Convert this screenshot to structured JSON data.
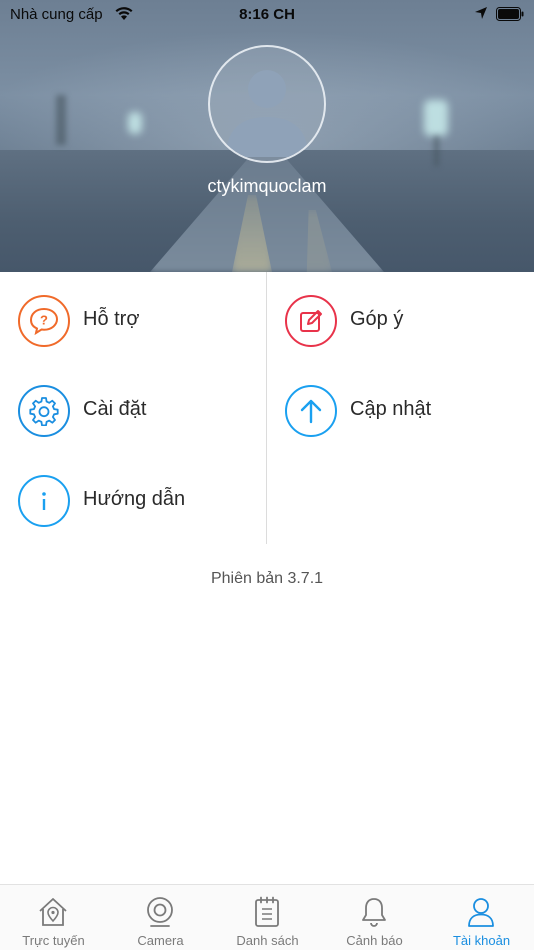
{
  "status_bar": {
    "carrier": "Nhà cung cấp",
    "time": "8:16 CH"
  },
  "profile": {
    "username": "ctykimquoclam"
  },
  "menu": {
    "items": [
      {
        "label": "Hỗ trợ",
        "icon": "help-bubble-icon",
        "color": "#f06a2a"
      },
      {
        "label": "Góp ý",
        "icon": "edit-note-icon",
        "color": "#e8334a"
      },
      {
        "label": "Cài đặt",
        "icon": "gear-icon",
        "color": "#1a8ee0"
      },
      {
        "label": "Cập nhật",
        "icon": "arrow-up-icon",
        "color": "#1aa0f0"
      },
      {
        "label": "Hướng dẫn",
        "icon": "info-icon",
        "color": "#1aa0f0"
      }
    ]
  },
  "version_text": "Phiên bản 3.7.1",
  "tab_bar": {
    "active": "Tài khoản",
    "accent_color": "#1a8ee0",
    "tabs": [
      {
        "label": "Trực tuyến",
        "icon": "home-location-icon"
      },
      {
        "label": "Camera",
        "icon": "camera-icon"
      },
      {
        "label": "Danh sách",
        "icon": "notepad-list-icon"
      },
      {
        "label": "Cảnh báo",
        "icon": "bell-icon"
      },
      {
        "label": "Tài khoản",
        "icon": "user-icon"
      }
    ]
  }
}
